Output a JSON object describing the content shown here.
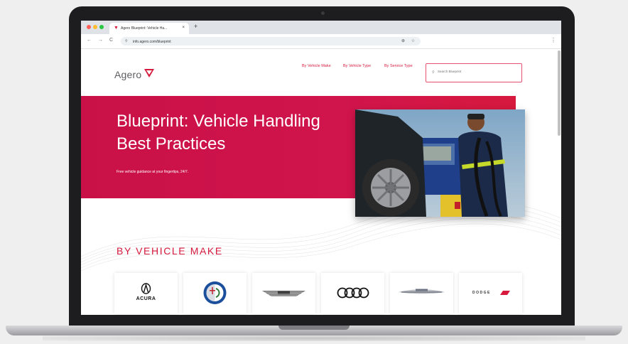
{
  "browser": {
    "tab_title": "Agero Blueprint: Vehicle Ha...",
    "tab_close": "×",
    "new_tab": "+",
    "url": "info.agero.com/blueprint",
    "back": "←",
    "forward": "→",
    "reload": "C",
    "menu": "⋮",
    "lock": "⚲",
    "zoom": "⊕",
    "star": "☆"
  },
  "header": {
    "logo_text": "Agero",
    "nav": [
      {
        "label": "By Vehicle Make"
      },
      {
        "label": "By Vehicle Type"
      },
      {
        "label": "By Service Type"
      }
    ],
    "search_placeholder": "Search Blueprint"
  },
  "hero": {
    "title": "Blueprint: Vehicle Handling Best Practices",
    "subtitle": "Free vehicle guidance at your fingertips, 24/7."
  },
  "section": {
    "title": "BY VEHICLE MAKE"
  },
  "brands": [
    {
      "name": "ACURA",
      "icon": "acura-logo"
    },
    {
      "name": "Alfa Romeo",
      "icon": "alfa-romeo-logo"
    },
    {
      "name": "Aston Martin",
      "icon": "aston-martin-logo"
    },
    {
      "name": "Audi",
      "icon": "audi-logo"
    },
    {
      "name": "Chrysler",
      "icon": "chrysler-logo"
    },
    {
      "name": "DODGE",
      "icon": "dodge-logo"
    }
  ],
  "colors": {
    "brand_red": "#d6193d",
    "hero_red": "#c91147",
    "laptop": "#1d1d1f"
  }
}
